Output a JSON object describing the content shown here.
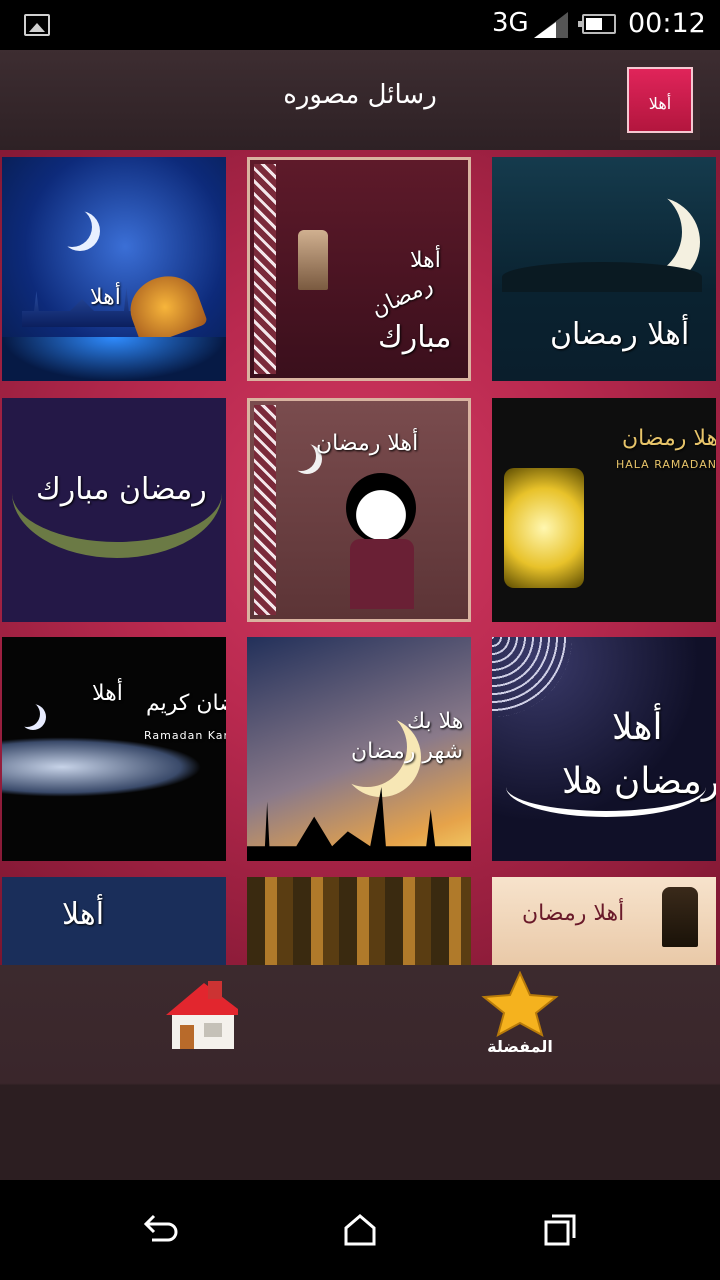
{
  "status_bar": {
    "network": "3G",
    "time": "00:12",
    "icons": [
      "image-notification-icon",
      "signal-icon",
      "battery-icon"
    ]
  },
  "header": {
    "title": "رسائل مصوره",
    "logo_text": "أهلا رمضان"
  },
  "grid": {
    "tiles": [
      {
        "row": 1,
        "col": 1,
        "captions": [
          "أهلا"
        ]
      },
      {
        "row": 1,
        "col": 2,
        "captions": [
          "أهلا",
          "رمضان",
          "مبارك"
        ]
      },
      {
        "row": 1,
        "col": 3,
        "captions": [
          "أهلا رمضان"
        ]
      },
      {
        "row": 2,
        "col": 1,
        "captions": [
          "رمضان مبارك"
        ]
      },
      {
        "row": 2,
        "col": 2,
        "captions": [
          "أهلا رمضان"
        ]
      },
      {
        "row": 2,
        "col": 3,
        "captions": [
          "هلا رمضان",
          "HALA RAMADAN"
        ]
      },
      {
        "row": 3,
        "col": 1,
        "captions": [
          "أهلا",
          "رمضان كريم",
          "Ramadan Kareem"
        ]
      },
      {
        "row": 3,
        "col": 2,
        "captions": [
          "هلا بك",
          "يا شهر رمضان"
        ]
      },
      {
        "row": 3,
        "col": 3,
        "captions": [
          "أهلا",
          "رمضان هلا"
        ]
      },
      {
        "row": 4,
        "col": 1,
        "captions": [
          "أهلا"
        ]
      },
      {
        "row": 4,
        "col": 2,
        "captions": []
      },
      {
        "row": 4,
        "col": 3,
        "captions": [
          "أهلا رمضان"
        ]
      }
    ]
  },
  "bottom_bar": {
    "home_icon": "home-icon",
    "favorites_icon": "star-icon",
    "favorites_label": "المفضلة"
  },
  "nav_bar": {
    "buttons": [
      "back-icon",
      "home-nav-icon",
      "recents-icon"
    ]
  },
  "colors": {
    "accent": "#c22a52",
    "header_bg": "#3a2a2e",
    "logo_red": "#d81f4f",
    "star_gold": "#f5b21e"
  }
}
